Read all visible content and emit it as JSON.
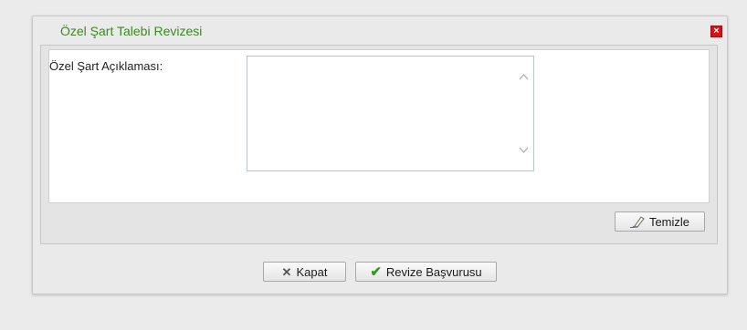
{
  "dialog": {
    "title": "Özel Şart Talebi Revizesi",
    "close_icon": "close-icon"
  },
  "form": {
    "description_label": "Özel Şart Açıklaması:",
    "description_value": ""
  },
  "buttons": {
    "clear_label": "Temizle",
    "clear_icon": "eraser-icon",
    "close_label": "Kapat",
    "close_icon": "x-icon",
    "submit_label": "Revize Başvurusu",
    "submit_icon": "checkmark-icon"
  },
  "colors": {
    "title": "#3b8a22",
    "close_button": "#d4121a",
    "check": "#2f9a1e"
  }
}
